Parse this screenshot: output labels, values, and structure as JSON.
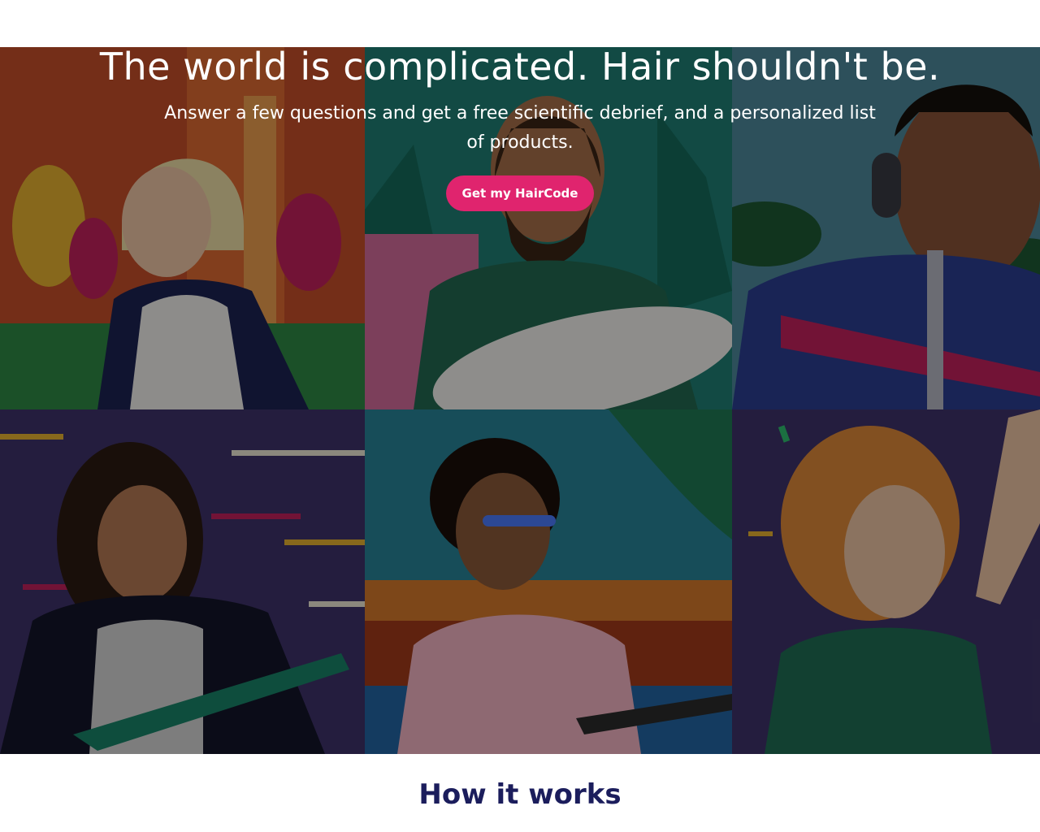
{
  "hero": {
    "headline": "The world is complicated. Hair shouldn't be.",
    "subheadline": "Answer a few questions and get a free scientific debrief, and a personalized list of products.",
    "cta_label": "Get my HairCode"
  },
  "section": {
    "how_it_works": "How it works"
  },
  "colors": {
    "cta": "#e0246e",
    "heading": "#1b1d5c"
  }
}
